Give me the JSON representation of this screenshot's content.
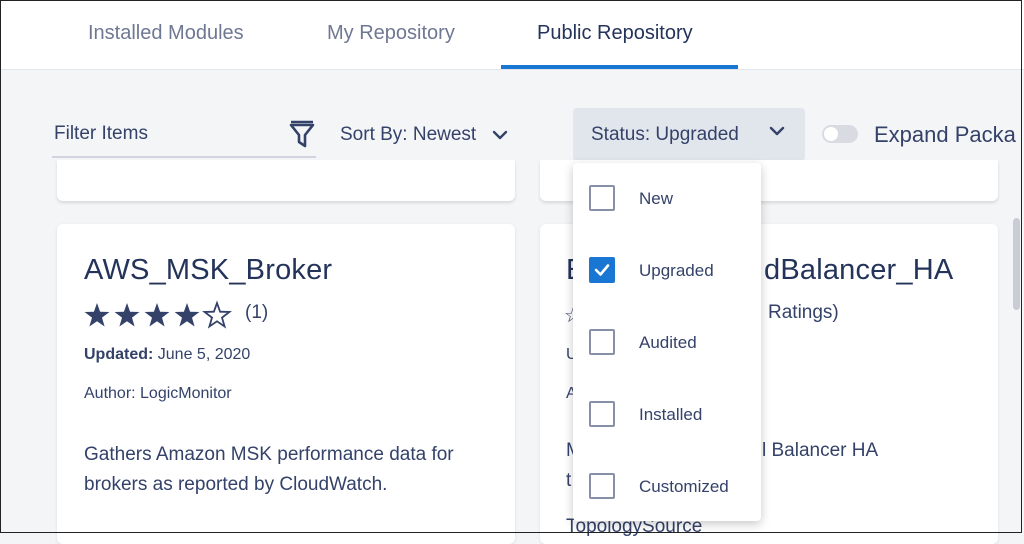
{
  "tabs": [
    {
      "label": "Installed Modules",
      "active": false
    },
    {
      "label": "My Repository",
      "active": false
    },
    {
      "label": "Public Repository",
      "active": true
    }
  ],
  "toolbar": {
    "filter_placeholder": "Filter Items",
    "sort_label": "Sort By: Newest",
    "status_label": "Status: Upgraded",
    "expand_label": "Expand Packa",
    "expand_on": false
  },
  "cards": [
    {
      "title": "AWS_MSK_Broker",
      "rating_count": "(1)",
      "stars_filled": 4,
      "stars_total": 5,
      "updated_label": "Updated:",
      "updated_value": "June 5, 2020",
      "author": "Author: LogicMonitor",
      "description": "Gathers Amazon MSK performance data for brokers as reported by CloudWatch."
    },
    {
      "title_left": "E",
      "title_right": "dBalancer_HA",
      "ratings_text": "Ratings)",
      "meta_u": "U",
      "meta_a": "A",
      "desc_left": "M",
      "desc_right": "l Balancer HA",
      "desc_t": "t",
      "bottom_text": "TopologySource"
    }
  ],
  "status_dropdown": {
    "options": [
      {
        "label": "New",
        "checked": false
      },
      {
        "label": "Upgraded",
        "checked": true
      },
      {
        "label": "Audited",
        "checked": false
      },
      {
        "label": "Installed",
        "checked": false
      },
      {
        "label": "Customized",
        "checked": false
      }
    ]
  },
  "colors": {
    "accent": "#1976d2",
    "text": "#24335a",
    "muted": "#6f7893"
  }
}
